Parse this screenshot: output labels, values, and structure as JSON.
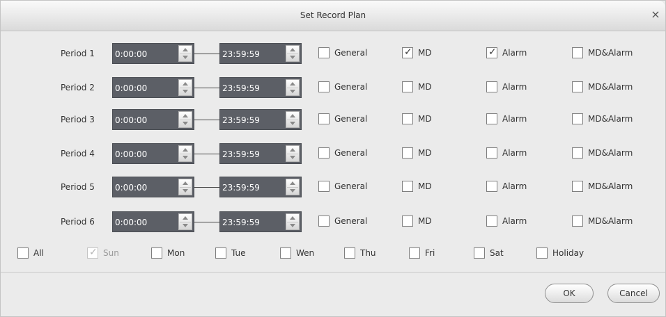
{
  "dialog": {
    "title": "Set Record Plan",
    "close_glyph": "×",
    "close_icon": "close-icon"
  },
  "periods": [
    {
      "label": "Period 1",
      "start": "0:00:00",
      "end": "23:59:59",
      "general": false,
      "md": true,
      "alarm": true,
      "md_alarm": false
    },
    {
      "label": "Period 2",
      "start": "0:00:00",
      "end": "23:59:59",
      "general": false,
      "md": false,
      "alarm": false,
      "md_alarm": false
    },
    {
      "label": "Period 3",
      "start": "0:00:00",
      "end": "23:59:59",
      "general": false,
      "md": false,
      "alarm": false,
      "md_alarm": false
    },
    {
      "label": "Period 4",
      "start": "0:00:00",
      "end": "23:59:59",
      "general": false,
      "md": false,
      "alarm": false,
      "md_alarm": false
    },
    {
      "label": "Period 5",
      "start": "0:00:00",
      "end": "23:59:59",
      "general": false,
      "md": false,
      "alarm": false,
      "md_alarm": false
    },
    {
      "label": "Period 6",
      "start": "0:00:00",
      "end": "23:59:59",
      "general": false,
      "md": false,
      "alarm": false,
      "md_alarm": false
    }
  ],
  "record_types": {
    "general": "General",
    "md": "MD",
    "alarm": "Alarm",
    "md_alarm": "MD&Alarm"
  },
  "days": [
    {
      "key": "all",
      "label": "All",
      "checked": false,
      "disabled": false
    },
    {
      "key": "sun",
      "label": "Sun",
      "checked": true,
      "disabled": true
    },
    {
      "key": "mon",
      "label": "Mon",
      "checked": false,
      "disabled": false
    },
    {
      "key": "tue",
      "label": "Tue",
      "checked": false,
      "disabled": false
    },
    {
      "key": "wen",
      "label": "Wen",
      "checked": false,
      "disabled": false
    },
    {
      "key": "thu",
      "label": "Thu",
      "checked": false,
      "disabled": false
    },
    {
      "key": "fri",
      "label": "Fri",
      "checked": false,
      "disabled": false
    },
    {
      "key": "sat",
      "label": "Sat",
      "checked": false,
      "disabled": false
    },
    {
      "key": "holiday",
      "label": "Holiday",
      "checked": false,
      "disabled": false
    }
  ],
  "buttons": {
    "ok": "OK",
    "cancel": "Cancel"
  },
  "check_glyph": "✓"
}
